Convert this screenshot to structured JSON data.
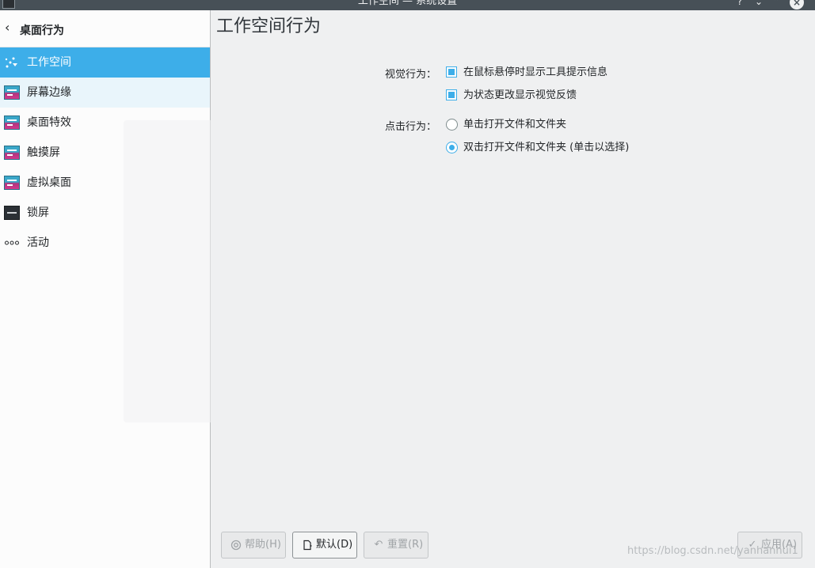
{
  "window": {
    "title": "工作空间 — 系统设置",
    "help_glyph": "?",
    "minimize_glyph": "⌄",
    "maximize_glyph": "⌃",
    "close_glyph": "×"
  },
  "sidebar": {
    "back_label": "桌面行为",
    "back_icon": "chevron-left-icon",
    "items": [
      {
        "label": "工作空间",
        "icon": "workspace-icon",
        "active": true
      },
      {
        "label": "屏幕边缘",
        "icon": "screen-edges-icon"
      },
      {
        "label": "桌面特效",
        "icon": "desktop-effects-icon"
      },
      {
        "label": "触摸屏",
        "icon": "touchscreen-icon"
      },
      {
        "label": "虚拟桌面",
        "icon": "virtual-desktops-icon"
      },
      {
        "label": "锁屏",
        "icon": "lock-screen-icon"
      },
      {
        "label": "活动",
        "icon": "activities-icon"
      }
    ]
  },
  "main": {
    "title": "工作空间行为",
    "visual": {
      "label": "视觉行为：",
      "options": [
        {
          "label": "在鼠标悬停时显示工具提示信息",
          "checked": true
        },
        {
          "label": "为状态更改显示视觉反馈",
          "checked": true
        }
      ]
    },
    "click": {
      "label": "点击行为：",
      "options": [
        {
          "label": "单击打开文件和文件夹",
          "selected": false
        },
        {
          "label": "双击打开文件和文件夹 (单击以选择)",
          "selected": true
        }
      ]
    }
  },
  "buttons": {
    "help": "帮助(H)",
    "defaults": "默认(D)",
    "reset": "重置(R)",
    "apply": "应用(A)"
  },
  "watermark": "https://blog.csdn.net/yanhanhui1",
  "colors": {
    "accent": "#3daee9",
    "titlebar": "#475057",
    "window_bg": "#eff0f1"
  }
}
